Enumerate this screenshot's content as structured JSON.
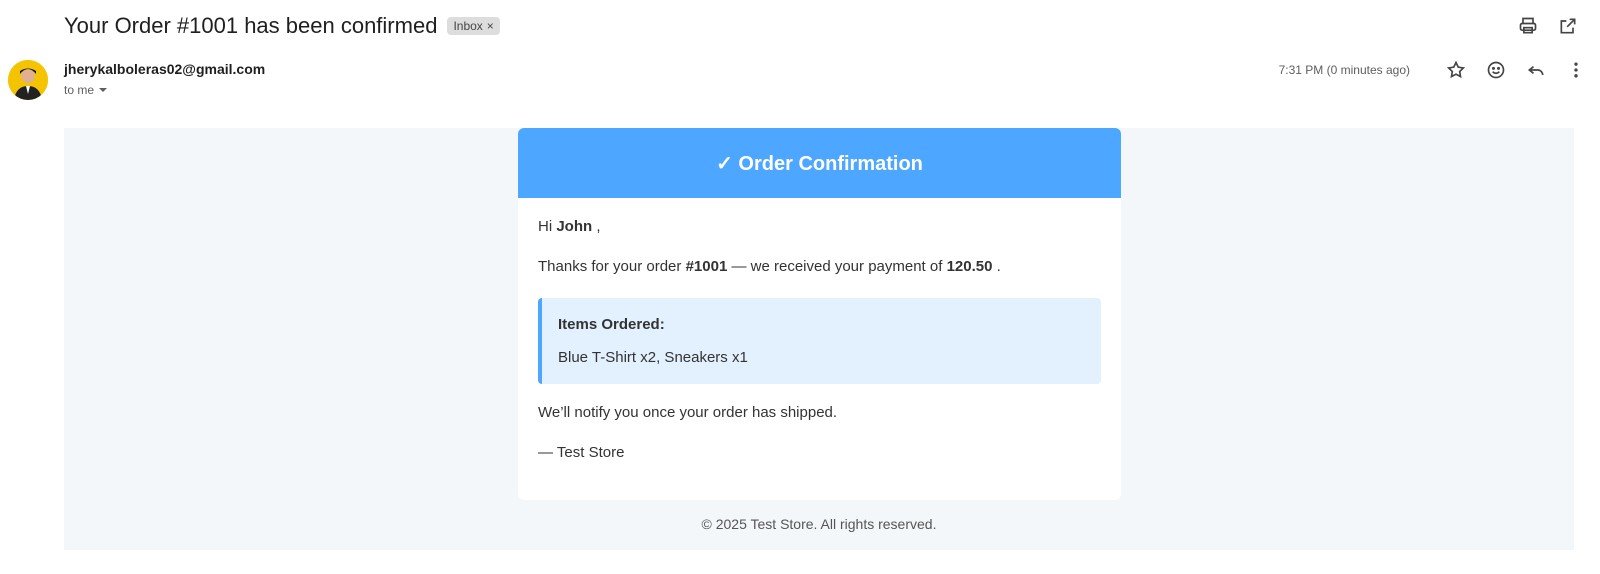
{
  "subject": "Your Order #1001 has been confirmed",
  "label": "Inbox",
  "label_remove": "×",
  "sender": "jherykalboleras02@gmail.com",
  "recipient": "to me",
  "timestamp": "7:31 PM (0 minutes ago)",
  "icons": {
    "print": "print-icon",
    "open": "open-in-new-window-icon",
    "star": "star-icon",
    "emoji": "emoji-icon",
    "reply": "reply-icon",
    "more": "more-vertical-icon"
  },
  "email": {
    "header_title": "✓ Order Confirmation",
    "greeting_prefix": "Hi",
    "customer_name": "John",
    "greeting_suffix": ",",
    "thanks_prefix": "Thanks for your order",
    "order_number": "#1001",
    "thanks_middle": "— we received your payment of",
    "amount": "120.50",
    "thanks_suffix": ".",
    "items_title": "Items Ordered:",
    "items": "Blue T-Shirt x2, Sneakers x1",
    "notify": "We’ll notify you once your order has shipped.",
    "signature": "— Test Store",
    "footer": "© 2025 Test Store. All rights reserved."
  },
  "colors": {
    "accent": "#4da6ff",
    "items_bg": "#e3f1ff",
    "email_bg": "#f4f7fa",
    "avatar_bg": "#f5c400"
  }
}
